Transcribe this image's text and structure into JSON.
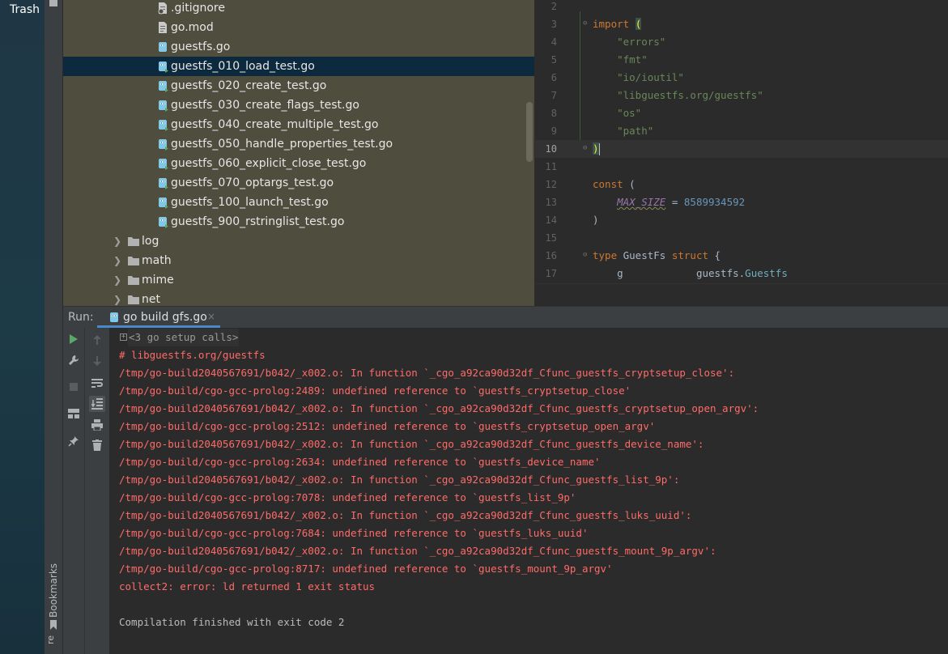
{
  "desktop": {
    "trash_label": "Trash"
  },
  "sidebar": {
    "bookmarks_label": "Bookmarks",
    "structure_label": "re"
  },
  "project_tree": {
    "rows": [
      {
        "label": ".gitignore",
        "type": "file-ignore",
        "indent": 2
      },
      {
        "label": "go.mod",
        "type": "file-text",
        "indent": 2
      },
      {
        "label": "guestfs.go",
        "type": "file-go",
        "indent": 2
      },
      {
        "label": "guestfs_010_load_test.go",
        "type": "file-go-test",
        "indent": 2,
        "selected": true
      },
      {
        "label": "guestfs_020_create_test.go",
        "type": "file-go-test",
        "indent": 2
      },
      {
        "label": "guestfs_030_create_flags_test.go",
        "type": "file-go-test",
        "indent": 2
      },
      {
        "label": "guestfs_040_create_multiple_test.go",
        "type": "file-go-test",
        "indent": 2
      },
      {
        "label": "guestfs_050_handle_properties_test.go",
        "type": "file-go-test",
        "indent": 2
      },
      {
        "label": "guestfs_060_explicit_close_test.go",
        "type": "file-go-test",
        "indent": 2
      },
      {
        "label": "guestfs_070_optargs_test.go",
        "type": "file-go-test",
        "indent": 2
      },
      {
        "label": "guestfs_100_launch_test.go",
        "type": "file-go-test",
        "indent": 2
      },
      {
        "label": "guestfs_900_rstringlist_test.go",
        "type": "file-go-test",
        "indent": 2
      },
      {
        "label": "log",
        "type": "folder",
        "indent": 1
      },
      {
        "label": "math",
        "type": "folder",
        "indent": 1
      },
      {
        "label": "mime",
        "type": "folder",
        "indent": 1
      },
      {
        "label": "net",
        "type": "folder",
        "indent": 1
      }
    ]
  },
  "editor": {
    "lines": [
      {
        "n": "2"
      },
      {
        "n": "3",
        "kw": "import",
        "rest": " ("
      },
      {
        "n": "4",
        "str": "\"errors\""
      },
      {
        "n": "5",
        "str": "\"fmt\""
      },
      {
        "n": "6",
        "str": "\"io/ioutil\""
      },
      {
        "n": "7",
        "str": "\"libguestfs.org/guestfs\""
      },
      {
        "n": "8",
        "str": "\"os\""
      },
      {
        "n": "9",
        "str": "\"path\""
      },
      {
        "n": "10",
        "text": ")"
      },
      {
        "n": "11"
      },
      {
        "n": "12",
        "kw": "const",
        "rest": " ("
      },
      {
        "n": "13",
        "name": "MAX_SIZE",
        "op": " = ",
        "num": "8589934592"
      },
      {
        "n": "14",
        "text": ")"
      },
      {
        "n": "15"
      },
      {
        "n": "16",
        "kw": "type",
        "mid": " GuestFs ",
        "kw2": "struct",
        "rest": " {"
      },
      {
        "n": "17",
        "field": "g",
        "pkg": "guestfs.",
        "ptype": "Guestfs"
      }
    ]
  },
  "run_panel": {
    "title": "Run:",
    "tab_label": "go build gfs.go",
    "tab_close": "×",
    "folded_text": "<3 go setup calls>",
    "fold_marker": "+",
    "lines": [
      {
        "style": "err",
        "text": "# libguestfs.org/guestfs"
      },
      {
        "style": "err",
        "text": "/tmp/go-build2040567691/b042/_x002.o: In function `_cgo_a92ca90d32df_Cfunc_guestfs_cryptsetup_close':"
      },
      {
        "style": "err",
        "text": "/tmp/go-build/cgo-gcc-prolog:2489: undefined reference to `guestfs_cryptsetup_close'"
      },
      {
        "style": "err",
        "text": "/tmp/go-build2040567691/b042/_x002.o: In function `_cgo_a92ca90d32df_Cfunc_guestfs_cryptsetup_open_argv':"
      },
      {
        "style": "err",
        "text": "/tmp/go-build/cgo-gcc-prolog:2512: undefined reference to `guestfs_cryptsetup_open_argv'"
      },
      {
        "style": "err",
        "text": "/tmp/go-build2040567691/b042/_x002.o: In function `_cgo_a92ca90d32df_Cfunc_guestfs_device_name':"
      },
      {
        "style": "err",
        "text": "/tmp/go-build/cgo-gcc-prolog:2634: undefined reference to `guestfs_device_name'"
      },
      {
        "style": "err",
        "text": "/tmp/go-build2040567691/b042/_x002.o: In function `_cgo_a92ca90d32df_Cfunc_guestfs_list_9p':"
      },
      {
        "style": "err",
        "text": "/tmp/go-build/cgo-gcc-prolog:7078: undefined reference to `guestfs_list_9p'"
      },
      {
        "style": "err",
        "text": "/tmp/go-build2040567691/b042/_x002.o: In function `_cgo_a92ca90d32df_Cfunc_guestfs_luks_uuid':"
      },
      {
        "style": "err",
        "text": "/tmp/go-build/cgo-gcc-prolog:7684: undefined reference to `guestfs_luks_uuid'"
      },
      {
        "style": "err",
        "text": "/tmp/go-build2040567691/b042/_x002.o: In function `_cgo_a92ca90d32df_Cfunc_guestfs_mount_9p_argv':"
      },
      {
        "style": "err",
        "text": "/tmp/go-build/cgo-gcc-prolog:8717: undefined reference to `guestfs_mount_9p_argv'"
      },
      {
        "style": "err",
        "text": "collect2: error: ld returned 1 exit status"
      },
      {
        "style": "plain",
        "text": ""
      },
      {
        "style": "plain",
        "text": "Compilation finished with exit code 2"
      }
    ]
  },
  "colors": {
    "tree_background": "#4f4d3e",
    "selection": "#0d293e",
    "error_text": "#ff6b68",
    "keyword": "#cc7832",
    "string": "#6a8759",
    "number": "#6897bb",
    "tab_underline": "#4a88c7"
  }
}
